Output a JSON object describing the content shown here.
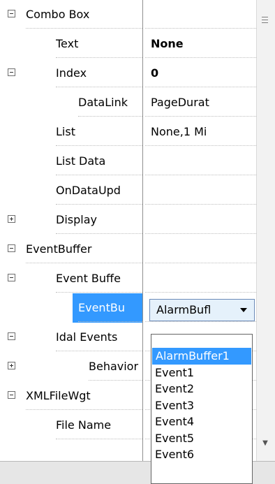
{
  "rows": [
    {
      "name": "Combo Box",
      "value": "",
      "expander": "minus"
    },
    {
      "name": "Text",
      "value": "None",
      "value_bold": true
    },
    {
      "name": "Index",
      "value": "0",
      "value_bold": true,
      "expander": "minus"
    },
    {
      "name": "DataLink",
      "value": "PageDurat"
    },
    {
      "name": "List",
      "value": "None,1 Mi"
    },
    {
      "name": "List Data",
      "value": ""
    },
    {
      "name": "OnDataUpd",
      "value": ""
    },
    {
      "name": "Display",
      "value": "",
      "expander": "plus"
    },
    {
      "name": "EventBuffer",
      "value": "",
      "expander": "minus"
    },
    {
      "name": "Event Buffe",
      "value": "",
      "expander": "minus"
    },
    {
      "name": "EventBu",
      "value": "",
      "selected": true
    },
    {
      "name": "Idal Events",
      "value": "",
      "expander": "minus"
    },
    {
      "name": "Behavior",
      "value": "",
      "expander": "plus"
    },
    {
      "name": "XMLFileWgt",
      "value": "",
      "expander": "minus"
    },
    {
      "name": "File Name",
      "value": ""
    }
  ],
  "combo": {
    "selected_value": "AlarmBufl"
  },
  "dropdown": {
    "options": [
      "AlarmBuffer1",
      "Event1",
      "Event2",
      "Event3",
      "Event4",
      "Event5",
      "Event6"
    ],
    "selected_index": 0
  },
  "colors": {
    "selection": "#3399ff",
    "grid_line": "#bdbdbd",
    "background": "#ffffff"
  }
}
